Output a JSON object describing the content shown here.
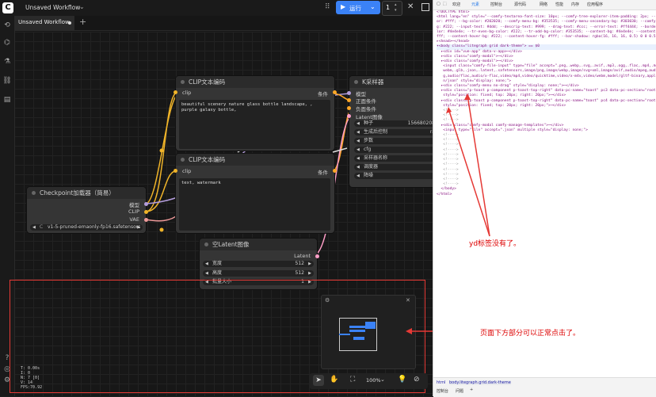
{
  "topbar": {
    "workflow_menu": "Unsaved Workflow",
    "run_label": "运行",
    "queue_count": "1"
  },
  "tab": {
    "label": "Unsaved Workflow"
  },
  "nodes": {
    "clip1": {
      "title": "CLIP文本编码",
      "in_port": "clip",
      "out_port": "条件",
      "text": "beautiful scenery nature glass bottle landscape, , purple galaxy bottle,"
    },
    "clip2": {
      "title": "CLIP文本编码",
      "in_port": "clip",
      "out_port": "条件",
      "text": "text, watermark"
    },
    "ksampler": {
      "title": "K采样器",
      "ports": [
        "模型",
        "正面条件",
        "负面条件",
        "Latent图像"
      ],
      "widgets": [
        {
          "label": "种子",
          "value": "156680208"
        },
        {
          "label": "生成后控制",
          "value": "ra"
        },
        {
          "label": "步数",
          "value": ""
        },
        {
          "label": "cfg",
          "value": ""
        },
        {
          "label": "采样器名称",
          "value": ""
        },
        {
          "label": "调度器",
          "value": ""
        },
        {
          "label": "降噪",
          "value": ""
        }
      ]
    },
    "checkpoint": {
      "title": "Checkpoint加载器（简易）",
      "outputs": [
        "模型",
        "CLIP",
        "VAE"
      ],
      "ckpt_prefix": "C",
      "ckpt_value": "v1-5-pruned-emaonly-fp16.safetensors"
    },
    "latent": {
      "title": "空Latent图像",
      "out_port": "Latent",
      "widgets": [
        {
          "label": "宽度",
          "value": "512"
        },
        {
          "label": "高度",
          "value": "512"
        },
        {
          "label": "批量大小",
          "value": "1"
        }
      ]
    }
  },
  "stats": [
    "T: 0.00s",
    "I: 0",
    "N: 7 [0]",
    "V: 14",
    "FPS:70.92"
  ],
  "zoom": "100%",
  "annotations": {
    "right_note": "yd标签没有了。",
    "bottom_note": "页面下方部分可以正常点击了。"
  },
  "devtools": {
    "tabs": [
      "欢迎",
      "元素",
      "控制台",
      "源代码",
      "网络",
      "性能",
      "内存",
      "应用程序"
    ],
    "code_lines": [
      "<!DOCTYPE html>",
      "<html lang=\"en\" style=\"--comfy-textarea-font-size: 10px; --comfy-tree-explorer-item-padding: 2px; --f",
      "or: #fff; --bg-color: #202020; --comfy-menu-bg: #353535; --comfy-menu-secondary-bg: #303030; --comfy-input",
      "g: #222; --input-text: #ddd; --descrip-text: #999; --drag-text: #ccc; --error-text: #ff4444; --border-co",
      "lor: #4e4e4e; --tr-even-bg-color: #222; --tr-odd-bg-color: #353535; --content-bg: #4e4e4e; --content-fg: #f",
      "fff; --content-hover-bg: #222; --content-hover-fg: #fff; --bar-shadow: rgba(16, 16, 16, 0.5) 0 0 0.5rem;\">",
      "▸<head>⋯</head>",
      "▾<body class=\"litegraph grid dark-theme\"> == $0",
      "  ▸<div id=\"vue-app\" data-v-app>⋯</div>",
      "  ▸<div class=\"comfy-modal\">⋯</div>",
      "  ▸<div class=\"comfy-modal\">⋯</div>",
      "   <input class=\"comfy-file-input\" type=\"file\" accept=\".png,.webp,.svg,.avif,.mp3,.ogg,.flac,.mp4,.mov,.m4v,.",
      "   webm,.glb,.json,.latent,.safetensors,image/png,image/webp,image/svg+xml,image/avif,audio/mpeg,audio/og",
      "   g,audio/flac,audio/x-flac,video/mp4,video/quicktime,video/x-m4v,video/webm,model/gltf-binary,applicatio",
      "   n/json\" style=\"display: none;\">",
      "  ▸<div class=\"comfy-menu no-drag\" style=\"display: none;\">⋯</div>",
      "  ▸<div class=\"p-toast p-component p-toast-top-right\" data-pc-name=\"toast\" pc3 data-pc-section=\"root\"",
      "   style=\"position: fixed; top: 20px; right: 20px;\">⋯</div>",
      "  ▸<div class=\"p-toast p-component p-toast-top-right\" data-pc-name=\"toast\" pc4 data-pc-section=\"root\"",
      "   style=\"position: fixed; top: 20px; right: 20px;\">⋯</div>",
      "   <!---->",
      "   <!---->",
      "   <!---->",
      "  ▸<div class=\"comfy-modal comfy-manage-templates\">⋯</div>",
      "   <input type=\"file\" accept=\".json\" multiple style=\"display: none;\">",
      "   <!---->",
      "   <!---->",
      "   <!---->",
      "   <!---->",
      "   <!---->",
      "   <!---->",
      "   <!---->",
      "   <!---->",
      "   <!---->",
      "   <!---->",
      "   <!---->",
      "  </body>",
      "</html>"
    ],
    "crumbs": [
      "html",
      "body.litegraph.grid.dark-theme"
    ],
    "bottom_tabs": [
      "控制台",
      "问题"
    ]
  }
}
